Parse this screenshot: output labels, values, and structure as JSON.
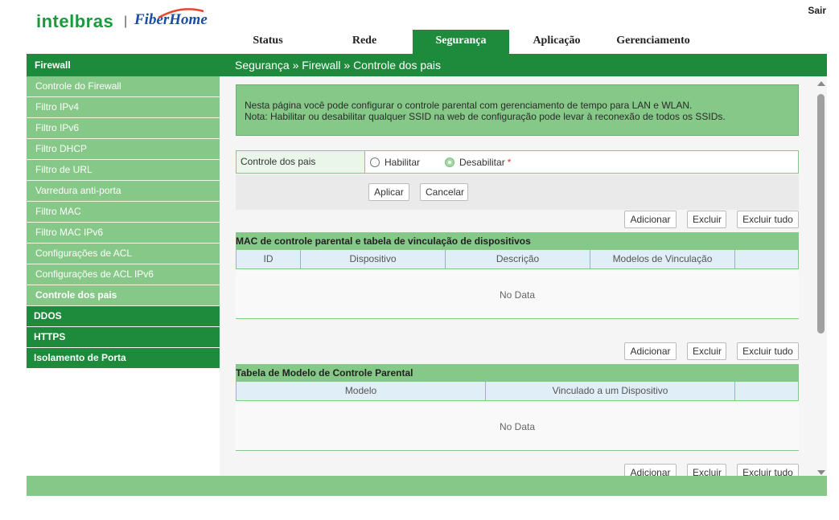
{
  "header": {
    "logo_intelbras": "intelbras",
    "logo_separator": "|",
    "logo_fiberhome": "FiberHome",
    "logout": "Sair"
  },
  "topnav": {
    "tabs": [
      {
        "label": "Status"
      },
      {
        "label": "Rede"
      },
      {
        "label": "Segurança",
        "active": true
      },
      {
        "label": "Aplicação"
      },
      {
        "label": "Gerenciamento"
      }
    ]
  },
  "titlebar": {
    "section": "Firewall",
    "breadcrumb": "Segurança » Firewall » Controle dos pais"
  },
  "sidebar": {
    "items": [
      {
        "label": "Controle do Firewall"
      },
      {
        "label": "Filtro IPv4"
      },
      {
        "label": "Filtro IPv6"
      },
      {
        "label": "Filtro DHCP"
      },
      {
        "label": "Filtro de URL"
      },
      {
        "label": "Varredura anti-porta"
      },
      {
        "label": "Filtro MAC"
      },
      {
        "label": "Filtro MAC IPv6"
      },
      {
        "label": "Configurações de ACL"
      },
      {
        "label": "Configurações de ACL IPv6"
      },
      {
        "label": "Controle dos pais",
        "active": true
      }
    ],
    "groups": [
      {
        "label": "DDOS"
      },
      {
        "label": "HTTPS"
      },
      {
        "label": "Isolamento de Porta"
      }
    ]
  },
  "info": {
    "line1": "Nesta página você pode configurar o controle parental com gerenciamento de tempo para LAN e WLAN.",
    "line2": "Nota: Habilitar ou desabilitar qualquer SSID na web de configuração pode levar à reconexão de todos os SSIDs."
  },
  "control": {
    "label": "Controle dos pais",
    "enable_label": "Habilitar",
    "disable_label": "Desabilitar",
    "required_mark": "*",
    "selected": "Desabilitar"
  },
  "actions": {
    "apply": "Aplicar",
    "cancel": "Cancelar",
    "add": "Adicionar",
    "delete": "Excluir",
    "delete_all": "Excluir tudo"
  },
  "mac_table": {
    "title": "MAC de controle parental e tabela de vinculação de dispositivos",
    "columns": [
      "ID",
      "Dispositivo",
      "Descrição",
      "Modelos de Vinculação",
      ""
    ],
    "empty": "No Data"
  },
  "model_table": {
    "title": "Tabela de Modelo de Controle Parental",
    "columns": [
      "Modelo",
      "Vinculado a um Dispositivo",
      ""
    ],
    "empty": "No Data"
  },
  "colors": {
    "primary_green": "#1e8a3c",
    "light_green": "#86c887",
    "logo_green": "#1a9a3c",
    "logo_blue": "#1a4ea0"
  }
}
